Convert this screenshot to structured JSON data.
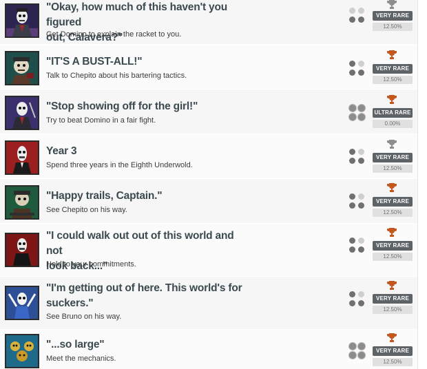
{
  "achievements": [
    {
      "title_line1": "\"Okay, how much of this haven't you figured",
      "title_line2": "out, Calavera?\"",
      "description": "Get Domino to explain the racket to you.",
      "rarity": "VERY RARE",
      "percent": "12.50%",
      "trophy": "silver-trophy-icon",
      "trophy_color": "#8e8e8e",
      "progress_dots": "2 of 4 filled",
      "icon": "domino-portrait-icon"
    },
    {
      "title_line1": "\"IT'S A BUST-ALL!\"",
      "title_line2": "",
      "description": "Talk to Chepito about his bartering tactics.",
      "rarity": "VERY RARE",
      "percent": "12.50%",
      "trophy": "bronze-trophy-icon",
      "trophy_color": "#c2581f",
      "progress_dots": "3 of 4 filled",
      "icon": "chepito-portrait-icon"
    },
    {
      "title_line1": "\"Stop showing off for the girl!\"",
      "title_line2": "",
      "description": "Try to beat Domino in a fair fight.",
      "rarity": "ULTRA RARE",
      "percent": "0.00%",
      "trophy": "bronze-trophy-icon",
      "trophy_color": "#c2581f",
      "progress_dots": "4 large grey",
      "icon": "domino-fight-icon"
    },
    {
      "title_line1": "Year 3",
      "title_line2": "",
      "description": "Spend three years in the Eighth Underwold.",
      "rarity": "VERY RARE",
      "percent": "12.50%",
      "trophy": "silver-trophy-icon",
      "trophy_color": "#8e8e8e",
      "progress_dots": "3 of 4 filled",
      "icon": "manny-portrait-icon"
    },
    {
      "title_line1": "\"Happy trails, Captain.\"",
      "title_line2": "",
      "description": "See Chepito on his way.",
      "rarity": "VERY RARE",
      "percent": "12.50%",
      "trophy": "bronze-trophy-icon",
      "trophy_color": "#c2581f",
      "progress_dots": "3 of 4 filled",
      "icon": "chepito-boat-icon"
    },
    {
      "title_line1": "\"I could walk out out of this world and not",
      "title_line2": "look back...\"",
      "description": "Hold to your commitments.",
      "rarity": "VERY RARE",
      "percent": "12.50%",
      "trophy": "bronze-trophy-icon",
      "trophy_color": "#c2581f",
      "progress_dots": "3 of 4 filled",
      "icon": "manny-walk-icon"
    },
    {
      "title_line1": "\"I'm getting out of here. This world's for",
      "title_line2": "suckers.\"",
      "description": "See Bruno on his way.",
      "rarity": "VERY RARE",
      "percent": "12.50%",
      "trophy": "bronze-trophy-icon",
      "trophy_color": "#c2581f",
      "progress_dots": "3 of 4 filled",
      "icon": "bruno-portrait-icon"
    },
    {
      "title_line1": "\"...so large\"",
      "title_line2": "",
      "description": "Meet the mechanics.",
      "rarity": "VERY RARE",
      "percent": "12.50%",
      "trophy": "bronze-trophy-icon",
      "trophy_color": "#c2581f",
      "progress_dots": "4 large grey",
      "icon": "mechanics-portrait-icon"
    }
  ]
}
